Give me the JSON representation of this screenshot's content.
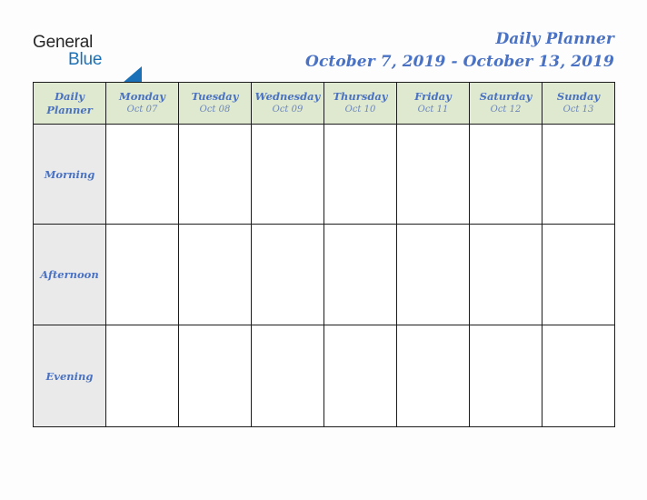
{
  "brand": {
    "word_one": "General",
    "word_two": "Blue",
    "triangle_icon": "triangle-icon",
    "accent_blue": "#1a71b8",
    "text_dark": "#272727"
  },
  "header": {
    "title": "Daily Planner",
    "date_range": "October 7, 2019 - October 13, 2019",
    "title_color": "#4a72c4"
  },
  "table": {
    "corner": {
      "line1": "Daily",
      "line2": "Planner"
    },
    "header_bg": "#dfe9cf",
    "row_label_bg": "#eaeaea",
    "cell_bg": "#ffffff",
    "border_color": "#1c1c1c",
    "columns": [
      {
        "day": "Monday",
        "date": "Oct 07"
      },
      {
        "day": "Tuesday",
        "date": "Oct 08"
      },
      {
        "day": "Wednesday",
        "date": "Oct 09"
      },
      {
        "day": "Thursday",
        "date": "Oct 10"
      },
      {
        "day": "Friday",
        "date": "Oct 11"
      },
      {
        "day": "Saturday",
        "date": "Oct 12"
      },
      {
        "day": "Sunday",
        "date": "Oct 13"
      }
    ],
    "rows": [
      {
        "label": "Morning",
        "cells": [
          "",
          "",
          "",
          "",
          "",
          "",
          ""
        ]
      },
      {
        "label": "Afternoon",
        "cells": [
          "",
          "",
          "",
          "",
          "",
          "",
          ""
        ]
      },
      {
        "label": "Evening",
        "cells": [
          "",
          "",
          "",
          "",
          "",
          "",
          ""
        ]
      }
    ]
  }
}
